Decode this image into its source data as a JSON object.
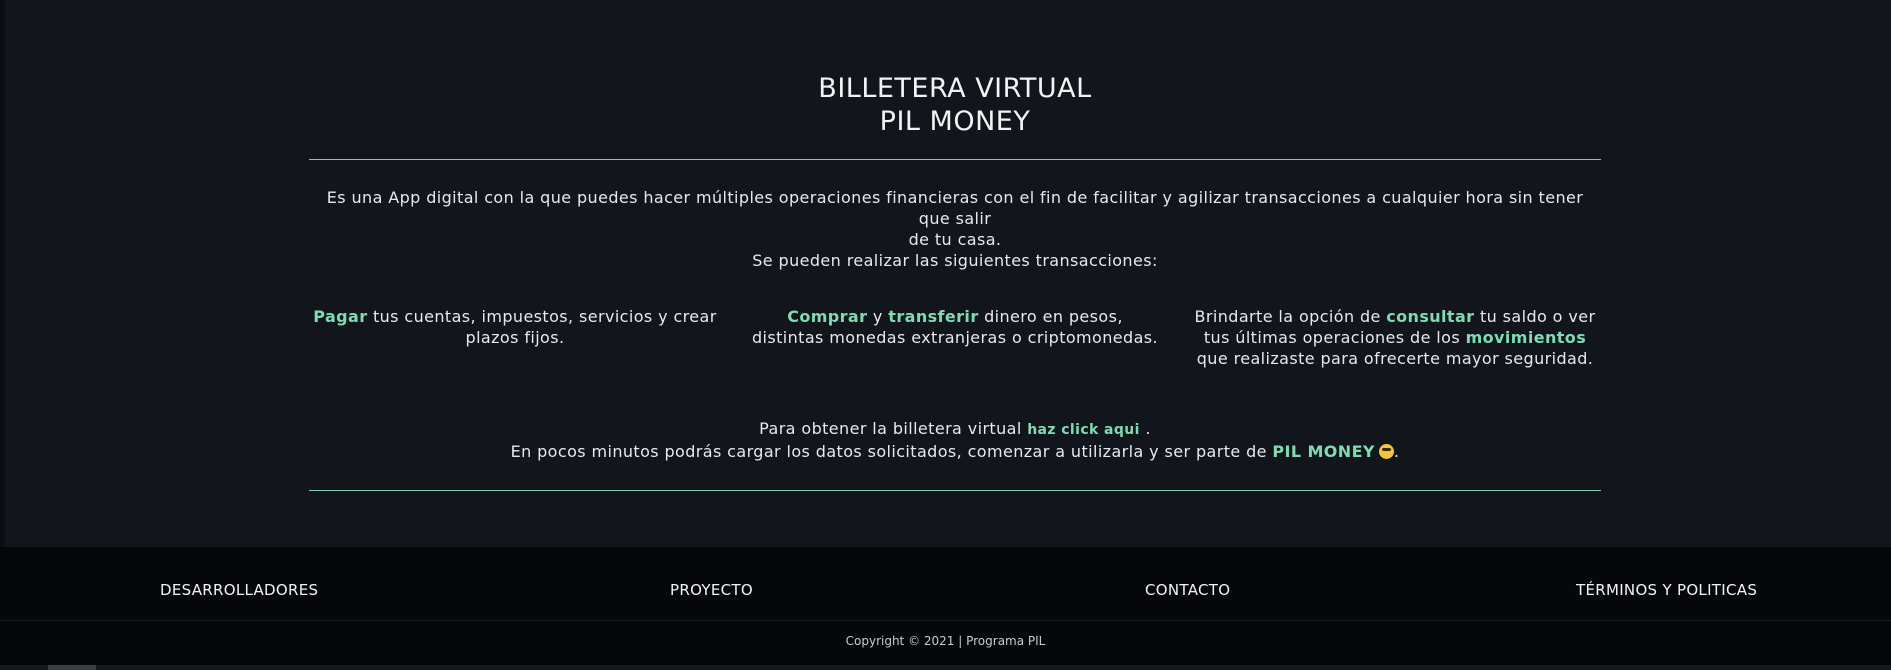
{
  "main": {
    "title_line1": "BILLETERA VIRTUAL",
    "title_line2": "PIL MONEY",
    "intro_line1": "Es una App digital con la que puedes hacer múltiples operaciones financieras con el fin de facilitar y agilizar transacciones a cualquier hora sin tener que salir",
    "intro_line2": "de tu casa.",
    "intro_line3": "Se pueden realizar las siguientes transacciones:",
    "features": [
      {
        "hl1": "Pagar",
        "text1": " tus cuentas, impuestos, servicios y crear plazos fijos."
      },
      {
        "hl1": "Comprar",
        "text1": " y ",
        "hl2": "transferir",
        "text2": " dinero en pesos, distintas monedas extranjeras o criptomonedas."
      },
      {
        "text0": "Brindarte la opción de ",
        "hl1": "consultar",
        "text1": " tu saldo o ver tus últimas operaciones de los ",
        "hl2": "movimientos",
        "text2": " que realizaste para ofrecerte mayor seguridad."
      }
    ],
    "cta": {
      "line1_text": "Para obtener la billetera virtual ",
      "link_label": "haz click aqui",
      "line1_end": " .",
      "line2_text": "En pocos minutos podrás cargar los datos solicitados, comenzar a utilizarla y ser parte de ",
      "brand": "PIL MONEY",
      "line2_end": "."
    }
  },
  "footer": {
    "links": [
      "DESARROLLADORES",
      "PROYECTO",
      "CONTACTO",
      "TÉRMINOS Y POLITICAS"
    ],
    "copyright": "Copyright © 2021 | Programa PIL"
  },
  "colors": {
    "accent": "#7fdcb0",
    "main_bg": "#12151b",
    "footer_bg": "#05070a"
  }
}
